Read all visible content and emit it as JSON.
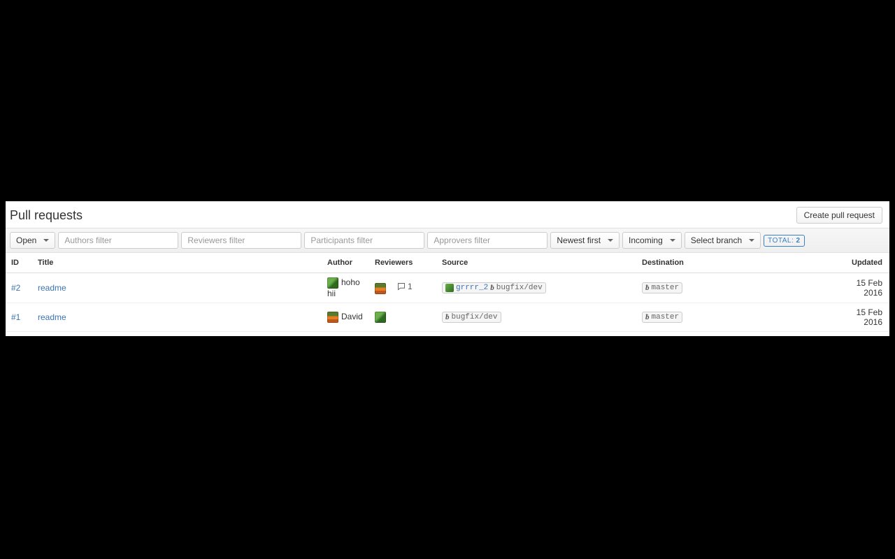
{
  "header": {
    "title": "Pull requests",
    "create_btn": "Create pull request"
  },
  "filters": {
    "state": "Open",
    "authors_placeholder": "Authors filter",
    "reviewers_placeholder": "Reviewers filter",
    "participants_placeholder": "Participants filter",
    "approvers_placeholder": "Approvers filter",
    "sort": "Newest first",
    "direction": "Incoming",
    "branch": "Select branch",
    "total_label": "TOTAL:",
    "total_count": "2"
  },
  "columns": {
    "id": "ID",
    "title": "Title",
    "author": "Author",
    "reviewers": "Reviewers",
    "source": "Source",
    "destination": "Destination",
    "updated": "Updated"
  },
  "rows": [
    {
      "id": "#2",
      "title": "readme",
      "author": "hoho hii",
      "author_avatar": "green",
      "reviewer_avatar": "orange",
      "comments": "1",
      "source_repo": "grrrr_2",
      "source_branch": "bugfix/dev",
      "dest_branch": "master",
      "updated": "15 Feb 2016"
    },
    {
      "id": "#1",
      "title": "readme",
      "author": "David",
      "author_avatar": "orange",
      "reviewer_avatar": "green",
      "comments": "",
      "source_repo": "",
      "source_branch": "bugfix/dev",
      "dest_branch": "master",
      "updated": "15 Feb 2016"
    }
  ]
}
